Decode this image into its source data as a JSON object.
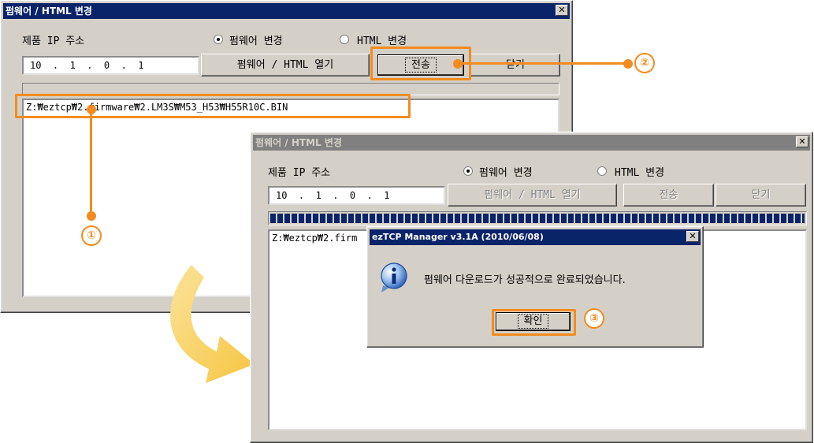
{
  "back_window": {
    "title": "펌웨어 / HTML 변경",
    "ip_label": "제품 IP 주소",
    "radio_firmware_label": "펌웨어 변경",
    "radio_html_label": "HTML 변경",
    "ip_value": "10  .  1  .  0  .  1",
    "open_button": "펌웨어 / HTML 열기",
    "send_button": "전송",
    "close_button": "닫기",
    "file_path": "Z:₩eztcp₩2.firmware₩2.LM3S₩M53_H53₩H55R10C.BIN"
  },
  "front_window": {
    "title": "펌웨어 / HTML 변경",
    "ip_label": "제품 IP 주소",
    "radio_firmware_label": "펌웨어 변경",
    "radio_html_label": "HTML 변경",
    "ip_value": "10  .  1  .  0  .  1",
    "open_button": "펌웨어 / HTML 열기",
    "send_button": "전송",
    "close_button": "닫기",
    "progress": 1.0,
    "file_path_partial": "Z:₩eztcp₩2.firm"
  },
  "dialog": {
    "title": "ezTCP Manager v3.1A (2010/06/08)",
    "message": "펌웨어 다운로드가 성공적으로 완료되었습니다.",
    "ok_button": "확인"
  },
  "annotations": {
    "step1": "①",
    "step2": "②",
    "step3": "③"
  },
  "colors": {
    "accent_orange": "#f38b1e",
    "arrow_yellow": "#f6c541",
    "titlebar_active": "#0a246a",
    "window_face": "#d4d0c8"
  }
}
